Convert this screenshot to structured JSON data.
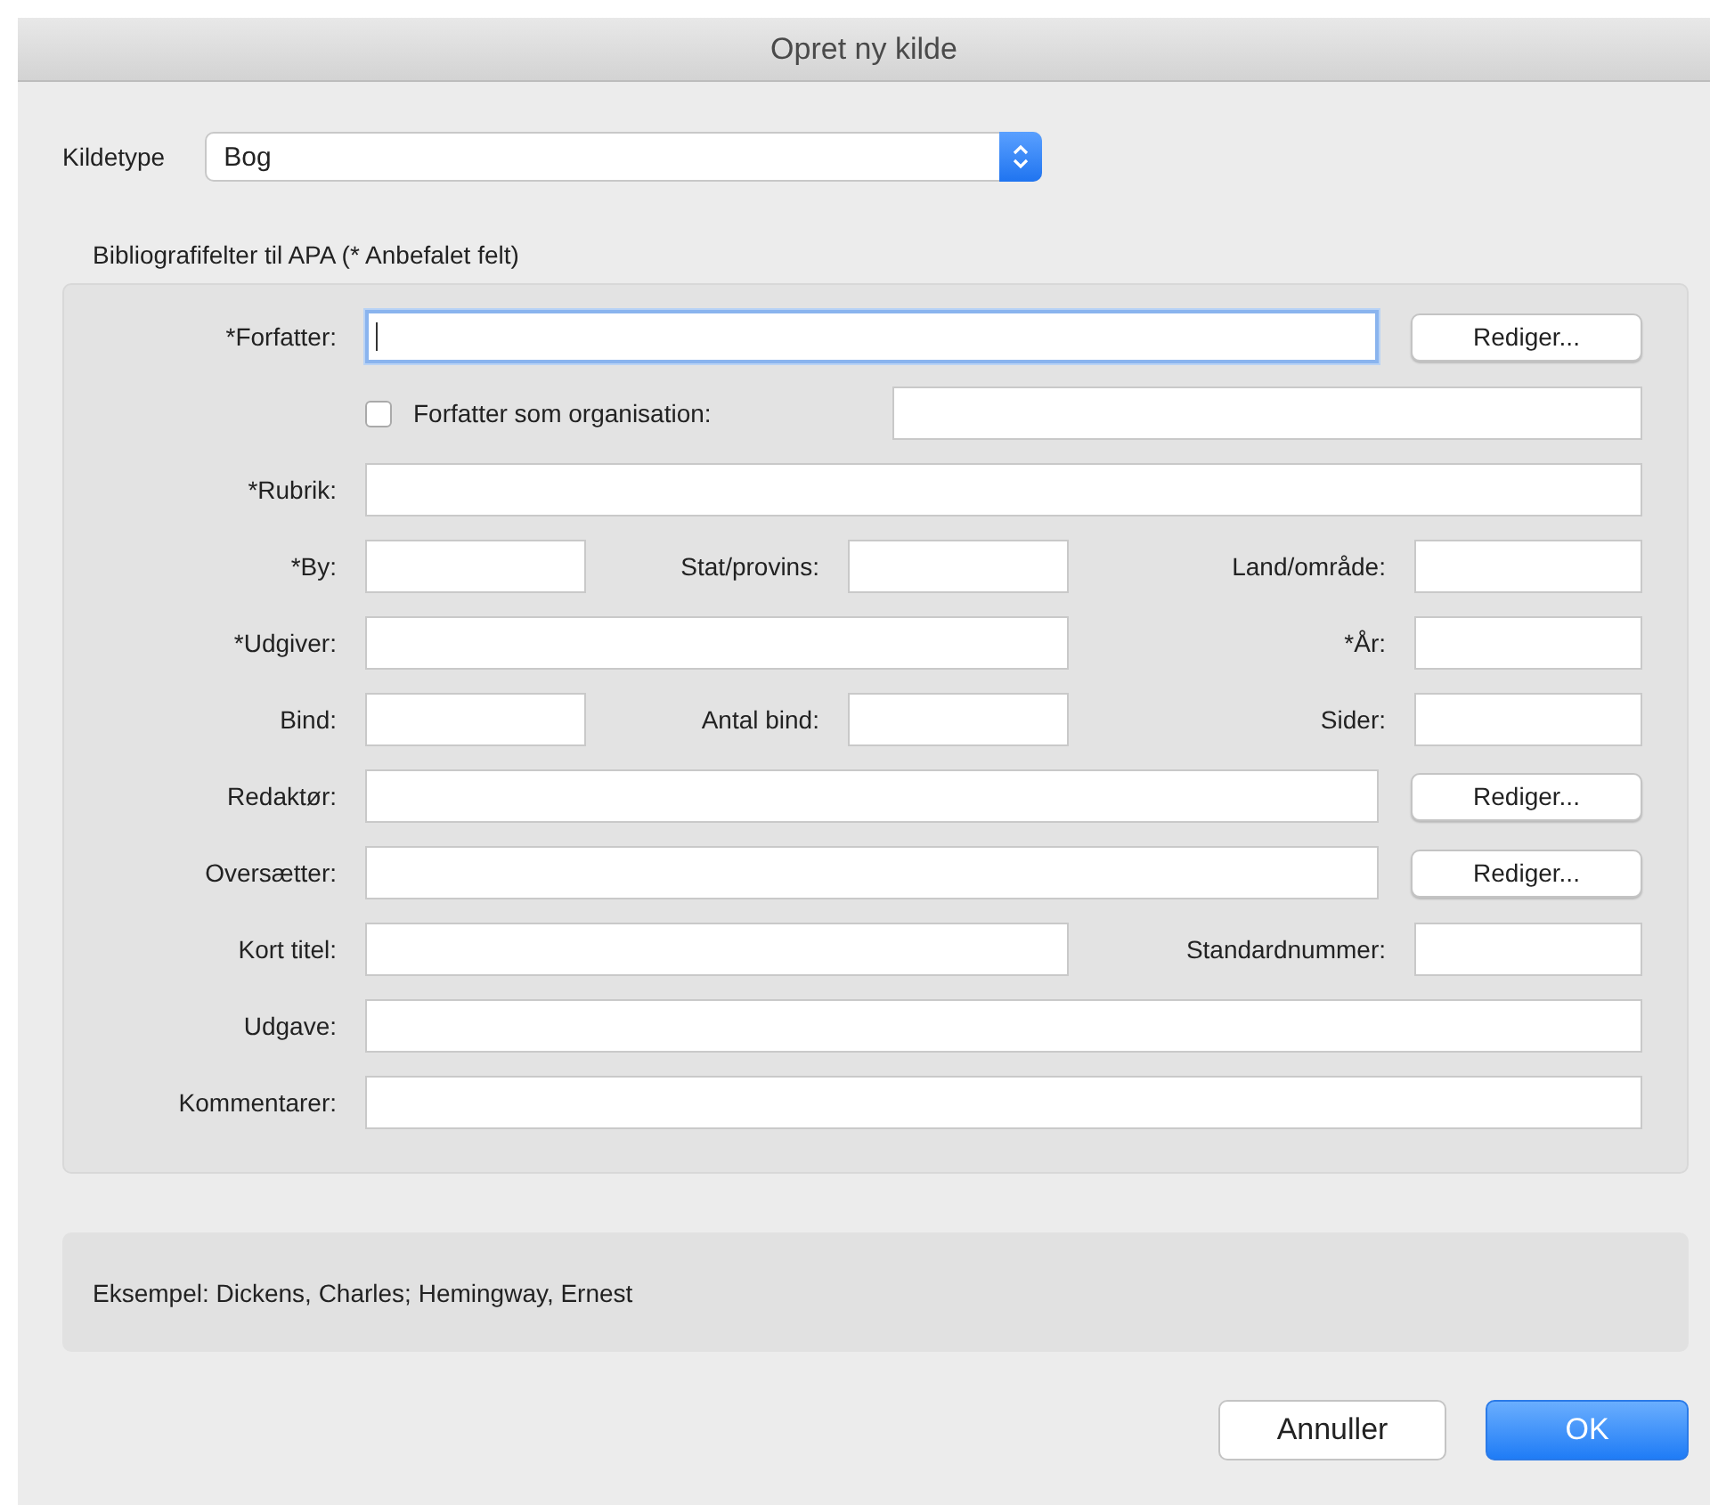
{
  "window": {
    "title": "Opret ny kilde"
  },
  "source_type": {
    "label": "Kildetype",
    "value": "Bog"
  },
  "fields_heading": "Bibliografifelter til APA  (* Anbefalet felt)",
  "rows": [
    {
      "kind": "field_button",
      "label": "*Forfatter:",
      "focused": true,
      "button": "Rediger..."
    },
    {
      "kind": "checkbox_field",
      "checkbox": {
        "label": "Forfatter som organisation:",
        "checked": false
      }
    },
    {
      "kind": "full",
      "label": "*Rubrik:"
    },
    {
      "kind": "three",
      "labels": [
        "*By:",
        "Stat/provins:",
        "Land/område:"
      ]
    },
    {
      "kind": "two",
      "labels": [
        "*Udgiver:",
        "*År:"
      ]
    },
    {
      "kind": "three",
      "labels": [
        "Bind:",
        "Antal bind:",
        "Sider:"
      ]
    },
    {
      "kind": "field_button",
      "label": "Redaktør:",
      "focused": false,
      "button": "Rediger..."
    },
    {
      "kind": "field_button",
      "label": "Oversætter:",
      "focused": false,
      "button": "Rediger..."
    },
    {
      "kind": "two",
      "labels": [
        "Kort titel:",
        "Standardnummer:"
      ]
    },
    {
      "kind": "full",
      "label": "Udgave:"
    },
    {
      "kind": "full",
      "label": "Kommentarer:"
    }
  ],
  "example": "Eksempel: Dickens, Charles; Hemingway, Ernest",
  "buttons": [
    {
      "label": "Annuller",
      "kind": "secondary"
    },
    {
      "label": "OK",
      "kind": "primary"
    }
  ]
}
